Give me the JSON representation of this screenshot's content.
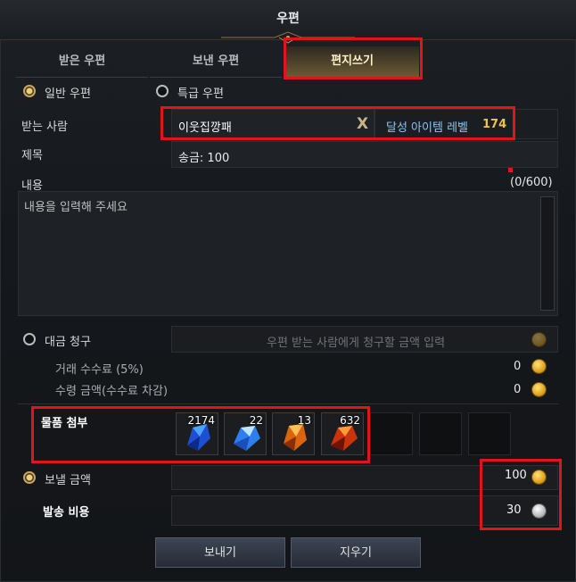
{
  "window": {
    "title": "우편"
  },
  "tabs": [
    {
      "label": "받은 우편"
    },
    {
      "label": "보낸 우편"
    },
    {
      "label": "편지쓰기"
    }
  ],
  "mail_type": {
    "normal": "일반 우편",
    "express": "특급 우편"
  },
  "recipient": {
    "label": "받는 사람",
    "value": "이웃집깡패",
    "clear": "X",
    "level_label": "달성 아이템 레벨",
    "level_value": "174"
  },
  "subject": {
    "label": "제목",
    "value": "송금: 100"
  },
  "content": {
    "label": "내용",
    "counter": "(0/600)",
    "placeholder": "내용을 입력해 주세요"
  },
  "cod": {
    "label": "대금 청구",
    "placeholder": "우편 받는 사람에게 청구할 금액 입력",
    "fee_label": "거래 수수료 (5%)",
    "fee_value": "0",
    "receive_label": "수령 금액(수수료 차감)",
    "receive_value": "0"
  },
  "attachments": {
    "label": "물품 첨부",
    "items": [
      {
        "qty": "2174",
        "icon": "blue-crystal-icon"
      },
      {
        "qty": "22",
        "icon": "blue-crystal-bright-icon"
      },
      {
        "qty": "13",
        "icon": "orange-crystal-icon"
      },
      {
        "qty": "632",
        "icon": "red-crystal-icon"
      }
    ]
  },
  "send_gold": {
    "label": "보낼 금액",
    "value": "100"
  },
  "shipping": {
    "label": "발송 비용",
    "value": "30"
  },
  "buttons": {
    "send": "보내기",
    "clear": "지우기"
  },
  "colors": {
    "accent_gold": "#f0c24b",
    "level_blue": "#8fc4ec",
    "highlight_red": "#e0141b"
  }
}
